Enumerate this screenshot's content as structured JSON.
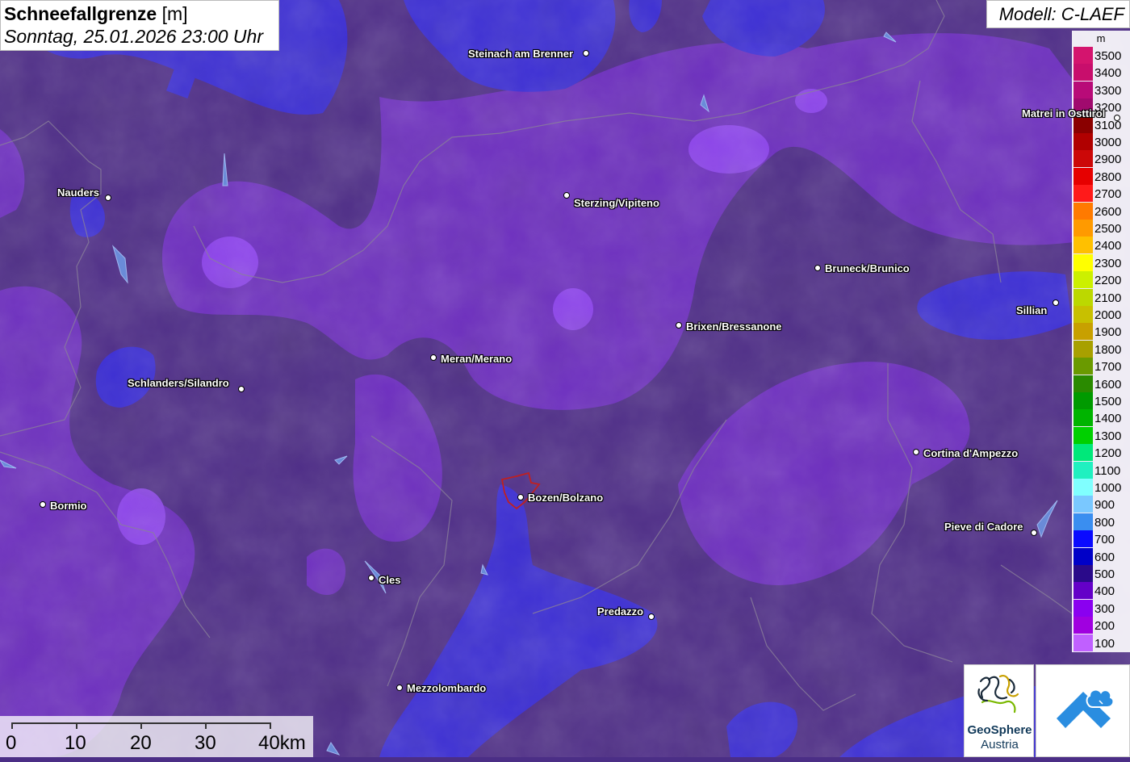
{
  "title": {
    "main": "Schneefallgrenze",
    "unit": "[m]",
    "datetime": "Sonntag, 25.01.2026 23:00 Uhr"
  },
  "model": "Modell: C-LAEF",
  "legend": {
    "unit": "m",
    "items": [
      {
        "label": "3500",
        "color": "#d4146e"
      },
      {
        "label": "3400",
        "color": "#c80e6c"
      },
      {
        "label": "3300",
        "color": "#b80b78"
      },
      {
        "label": "3200",
        "color": "#a00a6e"
      },
      {
        "label": "3100",
        "color": "#8a0000"
      },
      {
        "label": "3000",
        "color": "#b00000"
      },
      {
        "label": "2900",
        "color": "#cc0808"
      },
      {
        "label": "2800",
        "color": "#e60000"
      },
      {
        "label": "2700",
        "color": "#ff1a1a"
      },
      {
        "label": "2600",
        "color": "#ff7a00"
      },
      {
        "label": "2500",
        "color": "#ff9a00"
      },
      {
        "label": "2400",
        "color": "#ffc000"
      },
      {
        "label": "2300",
        "color": "#ffff00"
      },
      {
        "label": "2200",
        "color": "#ccf000"
      },
      {
        "label": "2100",
        "color": "#bcd800"
      },
      {
        "label": "2000",
        "color": "#c8c000"
      },
      {
        "label": "1900",
        "color": "#c8a000"
      },
      {
        "label": "1800",
        "color": "#a8a000"
      },
      {
        "label": "1700",
        "color": "#6a9a00"
      },
      {
        "label": "1600",
        "color": "#2a8a00"
      },
      {
        "label": "1500",
        "color": "#009a00"
      },
      {
        "label": "1400",
        "color": "#00b400"
      },
      {
        "label": "1300",
        "color": "#00d000"
      },
      {
        "label": "1200",
        "color": "#00e87a"
      },
      {
        "label": "1100",
        "color": "#20f0c0"
      },
      {
        "label": "1000",
        "color": "#80ffff"
      },
      {
        "label": "900",
        "color": "#7ac8ff"
      },
      {
        "label": "800",
        "color": "#3a8ef0"
      },
      {
        "label": "700",
        "color": "#0a0aff"
      },
      {
        "label": "600",
        "color": "#0000c8"
      },
      {
        "label": "500",
        "color": "#2a0a8a"
      },
      {
        "label": "400",
        "color": "#6400c8"
      },
      {
        "label": "300",
        "color": "#8a00f0"
      },
      {
        "label": "200",
        "color": "#a000e0"
      },
      {
        "label": "100",
        "color": "#c060ff"
      }
    ]
  },
  "cities": [
    {
      "name": "Steinach am Brenner"
    },
    {
      "name": "Matrei in Osttirol"
    },
    {
      "name": "Nauders"
    },
    {
      "name": "Sterzing/Vipiteno"
    },
    {
      "name": "Bruneck/Brunico"
    },
    {
      "name": "Sillian"
    },
    {
      "name": "Brixen/Bressanone"
    },
    {
      "name": "Meran/Merano"
    },
    {
      "name": "Schlanders/Silandro"
    },
    {
      "name": "Cortina d'Ampezzo"
    },
    {
      "name": "Bozen/Bolzano"
    },
    {
      "name": "Bormio"
    },
    {
      "name": "Pieve di Cadore"
    },
    {
      "name": "Cles"
    },
    {
      "name": "Predazzo"
    },
    {
      "name": "Mezzolombardo"
    }
  ],
  "scale": {
    "labels": [
      "0",
      "10",
      "20",
      "30",
      "40km"
    ]
  },
  "logos": {
    "geosphere_name": "GeoSphere",
    "geosphere_sub": "Austria"
  }
}
